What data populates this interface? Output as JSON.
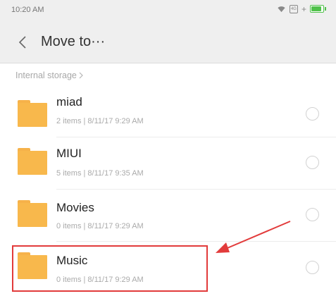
{
  "status_bar": {
    "time": "10:20 AM",
    "icons": [
      "wifi-icon",
      "sim-icon",
      "battery-icon"
    ],
    "battery_level": 0.75,
    "battery_color": "#4fc14a"
  },
  "header": {
    "back_icon": "chevron-left-icon",
    "title": "Move to···"
  },
  "breadcrumb": {
    "label": "Internal storage",
    "icon": "chevron-right-icon"
  },
  "folders": [
    {
      "name": "miad",
      "meta": "2 items | 8/11/17 9:29 AM",
      "selected": false
    },
    {
      "name": "MIUI",
      "meta": "5 items | 8/11/17 9:35 AM",
      "selected": false
    },
    {
      "name": "Movies",
      "meta": "0 items | 8/11/17 9:29 AM",
      "selected": false
    },
    {
      "name": "Music",
      "meta": "0 items | 8/11/17 9:29 AM",
      "selected": false
    }
  ],
  "annotation": {
    "highlight_color": "#e23b3b",
    "target": "Music"
  },
  "colors": {
    "folder": "#f8b84c",
    "header_bg": "#efefef"
  }
}
